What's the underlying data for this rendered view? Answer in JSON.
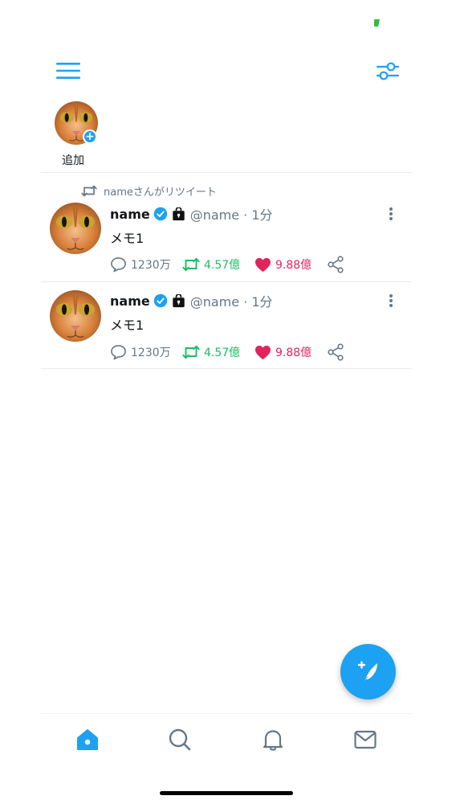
{
  "colors": {
    "accent": "#1da1f2",
    "muted": "#657786",
    "retweet": "#17bf63",
    "like": "#e0245e"
  },
  "header": {
    "menu_icon": "hamburger-menu-icon",
    "filter_icon": "sliders-icon"
  },
  "stories": {
    "add_label": "追加"
  },
  "retweet_context": {
    "label": "nameさんがリツイート"
  },
  "tweets": [
    {
      "name": "name",
      "handle": "@name · 1分",
      "text": "メモ1",
      "replies": "1230万",
      "retweets": "4.57億",
      "likes": "9.88億"
    },
    {
      "name": "name",
      "handle": "@name · 1分",
      "text": "メモ1",
      "replies": "1230万",
      "retweets": "4.57億",
      "likes": "9.88億"
    }
  ],
  "tabbar": {
    "items": [
      "home-icon",
      "search-icon",
      "bell-icon",
      "mail-icon"
    ]
  },
  "fab": {
    "icon": "compose-feather-icon"
  }
}
